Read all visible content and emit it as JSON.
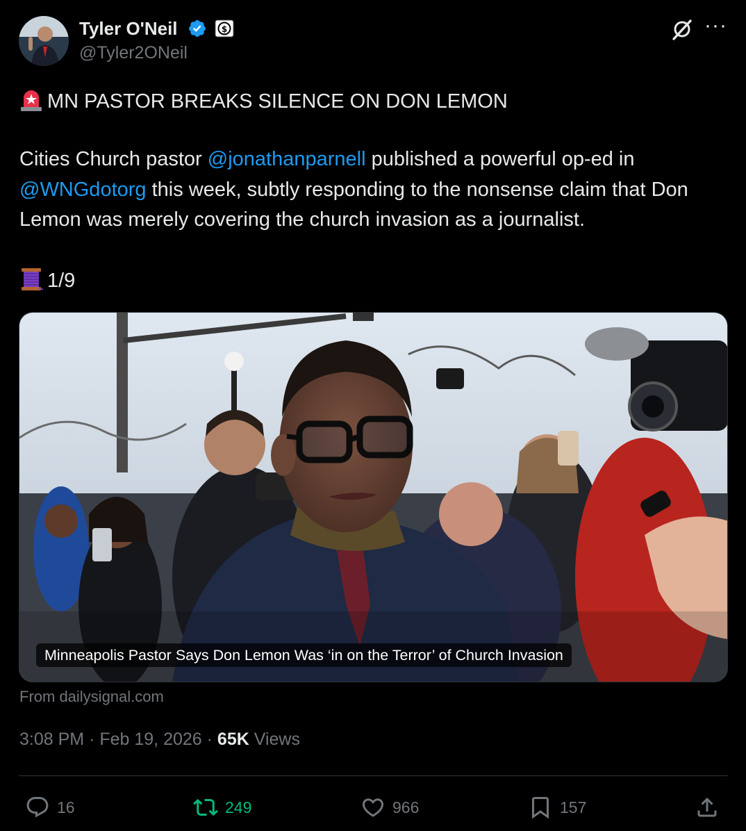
{
  "author": {
    "name": "Tyler O'Neil",
    "handle": "@Tyler2ONeil"
  },
  "post": {
    "headline": "MN PASTOR BREAKS SILENCE ON DON LEMON",
    "body_part1": "Cities Church pastor ",
    "mention1": "@jonathanparnell",
    "body_part2": " published a powerful op-ed in ",
    "mention2": "@WNGdotorg",
    "body_part3": " this week, subtly responding to the nonsense claim that Don Lemon was merely covering the church invasion as a journalist.",
    "thread_counter": "1/9"
  },
  "card": {
    "caption": "Minneapolis Pastor Says Don Lemon Was ‘in on the Terror’ of Church Invasion",
    "source": "From dailysignal.com"
  },
  "meta": {
    "time": "3:08 PM",
    "separator": "·",
    "date": "Feb 19, 2026",
    "views_count": "65K",
    "views_label": "Views"
  },
  "actions": {
    "replies": "16",
    "reposts": "249",
    "likes": "966",
    "bookmarks": "157"
  },
  "colors": {
    "background": "#000000",
    "text": "#e7e9ea",
    "secondary": "#71767b",
    "link": "#1d9bf0",
    "repost_active": "#00ba7c",
    "verified": "#1d9bf0"
  },
  "icons": [
    "avatar",
    "verified-badge-icon",
    "affiliate-badge-icon",
    "grok-icon",
    "more-icon",
    "siren-emoji-icon",
    "thread-spool-emoji-icon",
    "reply-icon",
    "repost-icon",
    "like-icon",
    "bookmark-icon",
    "share-icon"
  ]
}
